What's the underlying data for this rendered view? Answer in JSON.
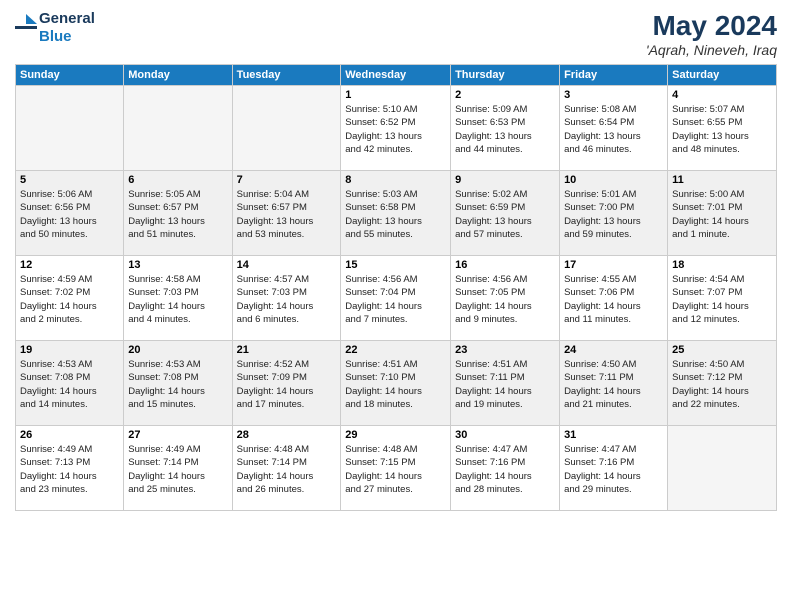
{
  "header": {
    "logo_line1": "General",
    "logo_line2": "Blue",
    "month": "May 2024",
    "location": "'Aqrah, Nineveh, Iraq"
  },
  "weekdays": [
    "Sunday",
    "Monday",
    "Tuesday",
    "Wednesday",
    "Thursday",
    "Friday",
    "Saturday"
  ],
  "weeks": [
    [
      {
        "day": "",
        "info": ""
      },
      {
        "day": "",
        "info": ""
      },
      {
        "day": "",
        "info": ""
      },
      {
        "day": "1",
        "info": "Sunrise: 5:10 AM\nSunset: 6:52 PM\nDaylight: 13 hours\nand 42 minutes."
      },
      {
        "day": "2",
        "info": "Sunrise: 5:09 AM\nSunset: 6:53 PM\nDaylight: 13 hours\nand 44 minutes."
      },
      {
        "day": "3",
        "info": "Sunrise: 5:08 AM\nSunset: 6:54 PM\nDaylight: 13 hours\nand 46 minutes."
      },
      {
        "day": "4",
        "info": "Sunrise: 5:07 AM\nSunset: 6:55 PM\nDaylight: 13 hours\nand 48 minutes."
      }
    ],
    [
      {
        "day": "5",
        "info": "Sunrise: 5:06 AM\nSunset: 6:56 PM\nDaylight: 13 hours\nand 50 minutes."
      },
      {
        "day": "6",
        "info": "Sunrise: 5:05 AM\nSunset: 6:57 PM\nDaylight: 13 hours\nand 51 minutes."
      },
      {
        "day": "7",
        "info": "Sunrise: 5:04 AM\nSunset: 6:57 PM\nDaylight: 13 hours\nand 53 minutes."
      },
      {
        "day": "8",
        "info": "Sunrise: 5:03 AM\nSunset: 6:58 PM\nDaylight: 13 hours\nand 55 minutes."
      },
      {
        "day": "9",
        "info": "Sunrise: 5:02 AM\nSunset: 6:59 PM\nDaylight: 13 hours\nand 57 minutes."
      },
      {
        "day": "10",
        "info": "Sunrise: 5:01 AM\nSunset: 7:00 PM\nDaylight: 13 hours\nand 59 minutes."
      },
      {
        "day": "11",
        "info": "Sunrise: 5:00 AM\nSunset: 7:01 PM\nDaylight: 14 hours\nand 1 minute."
      }
    ],
    [
      {
        "day": "12",
        "info": "Sunrise: 4:59 AM\nSunset: 7:02 PM\nDaylight: 14 hours\nand 2 minutes."
      },
      {
        "day": "13",
        "info": "Sunrise: 4:58 AM\nSunset: 7:03 PM\nDaylight: 14 hours\nand 4 minutes."
      },
      {
        "day": "14",
        "info": "Sunrise: 4:57 AM\nSunset: 7:03 PM\nDaylight: 14 hours\nand 6 minutes."
      },
      {
        "day": "15",
        "info": "Sunrise: 4:56 AM\nSunset: 7:04 PM\nDaylight: 14 hours\nand 7 minutes."
      },
      {
        "day": "16",
        "info": "Sunrise: 4:56 AM\nSunset: 7:05 PM\nDaylight: 14 hours\nand 9 minutes."
      },
      {
        "day": "17",
        "info": "Sunrise: 4:55 AM\nSunset: 7:06 PM\nDaylight: 14 hours\nand 11 minutes."
      },
      {
        "day": "18",
        "info": "Sunrise: 4:54 AM\nSunset: 7:07 PM\nDaylight: 14 hours\nand 12 minutes."
      }
    ],
    [
      {
        "day": "19",
        "info": "Sunrise: 4:53 AM\nSunset: 7:08 PM\nDaylight: 14 hours\nand 14 minutes."
      },
      {
        "day": "20",
        "info": "Sunrise: 4:53 AM\nSunset: 7:08 PM\nDaylight: 14 hours\nand 15 minutes."
      },
      {
        "day": "21",
        "info": "Sunrise: 4:52 AM\nSunset: 7:09 PM\nDaylight: 14 hours\nand 17 minutes."
      },
      {
        "day": "22",
        "info": "Sunrise: 4:51 AM\nSunset: 7:10 PM\nDaylight: 14 hours\nand 18 minutes."
      },
      {
        "day": "23",
        "info": "Sunrise: 4:51 AM\nSunset: 7:11 PM\nDaylight: 14 hours\nand 19 minutes."
      },
      {
        "day": "24",
        "info": "Sunrise: 4:50 AM\nSunset: 7:11 PM\nDaylight: 14 hours\nand 21 minutes."
      },
      {
        "day": "25",
        "info": "Sunrise: 4:50 AM\nSunset: 7:12 PM\nDaylight: 14 hours\nand 22 minutes."
      }
    ],
    [
      {
        "day": "26",
        "info": "Sunrise: 4:49 AM\nSunset: 7:13 PM\nDaylight: 14 hours\nand 23 minutes."
      },
      {
        "day": "27",
        "info": "Sunrise: 4:49 AM\nSunset: 7:14 PM\nDaylight: 14 hours\nand 25 minutes."
      },
      {
        "day": "28",
        "info": "Sunrise: 4:48 AM\nSunset: 7:14 PM\nDaylight: 14 hours\nand 26 minutes."
      },
      {
        "day": "29",
        "info": "Sunrise: 4:48 AM\nSunset: 7:15 PM\nDaylight: 14 hours\nand 27 minutes."
      },
      {
        "day": "30",
        "info": "Sunrise: 4:47 AM\nSunset: 7:16 PM\nDaylight: 14 hours\nand 28 minutes."
      },
      {
        "day": "31",
        "info": "Sunrise: 4:47 AM\nSunset: 7:16 PM\nDaylight: 14 hours\nand 29 minutes."
      },
      {
        "day": "",
        "info": ""
      }
    ]
  ]
}
